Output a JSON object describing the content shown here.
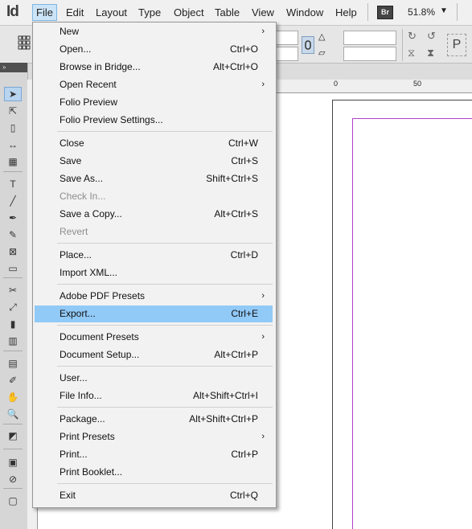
{
  "app": {
    "logo": "Id"
  },
  "menubar": {
    "items": [
      "File",
      "Edit",
      "Layout",
      "Type",
      "Object",
      "Table",
      "View",
      "Window",
      "Help"
    ],
    "bridge_badge": "Br",
    "zoom": "51.8%",
    "zoom_caret": "▼"
  },
  "panel": {
    "collapse": "»"
  },
  "ruler": {
    "tick_0": "0",
    "tick_50": "50"
  },
  "file_menu": {
    "items": [
      {
        "label": "New",
        "shortcut": "",
        "submenu": true,
        "enabled": true
      },
      {
        "label": "Open...",
        "shortcut": "Ctrl+O",
        "submenu": false,
        "enabled": true
      },
      {
        "label": "Browse in Bridge...",
        "shortcut": "Alt+Ctrl+O",
        "submenu": false,
        "enabled": true
      },
      {
        "label": "Open Recent",
        "shortcut": "",
        "submenu": true,
        "enabled": true
      },
      {
        "label": "Folio Preview",
        "shortcut": "",
        "submenu": false,
        "enabled": true
      },
      {
        "label": "Folio Preview Settings...",
        "shortcut": "",
        "submenu": false,
        "enabled": true
      },
      {
        "label": "Close",
        "shortcut": "Ctrl+W",
        "submenu": false,
        "enabled": true
      },
      {
        "label": "Save",
        "shortcut": "Ctrl+S",
        "submenu": false,
        "enabled": true
      },
      {
        "label": "Save As...",
        "shortcut": "Shift+Ctrl+S",
        "submenu": false,
        "enabled": true
      },
      {
        "label": "Check In...",
        "shortcut": "",
        "submenu": false,
        "enabled": false
      },
      {
        "label": "Save a Copy...",
        "shortcut": "Alt+Ctrl+S",
        "submenu": false,
        "enabled": true
      },
      {
        "label": "Revert",
        "shortcut": "",
        "submenu": false,
        "enabled": false
      },
      {
        "label": "Place...",
        "shortcut": "Ctrl+D",
        "submenu": false,
        "enabled": true
      },
      {
        "label": "Import XML...",
        "shortcut": "",
        "submenu": false,
        "enabled": true
      },
      {
        "label": "Adobe PDF Presets",
        "shortcut": "",
        "submenu": true,
        "enabled": true
      },
      {
        "label": "Export...",
        "shortcut": "Ctrl+E",
        "submenu": false,
        "enabled": true
      },
      {
        "label": "Document Presets",
        "shortcut": "",
        "submenu": true,
        "enabled": true
      },
      {
        "label": "Document Setup...",
        "shortcut": "Alt+Ctrl+P",
        "submenu": false,
        "enabled": true
      },
      {
        "label": "User...",
        "shortcut": "",
        "submenu": false,
        "enabled": true
      },
      {
        "label": "File Info...",
        "shortcut": "Alt+Shift+Ctrl+I",
        "submenu": false,
        "enabled": true
      },
      {
        "label": "Package...",
        "shortcut": "Alt+Shift+Ctrl+P",
        "submenu": false,
        "enabled": true
      },
      {
        "label": "Print Presets",
        "shortcut": "",
        "submenu": true,
        "enabled": true
      },
      {
        "label": "Print...",
        "shortcut": "Ctrl+P",
        "submenu": false,
        "enabled": true
      },
      {
        "label": "Print Booklet...",
        "shortcut": "",
        "submenu": false,
        "enabled": true
      },
      {
        "label": "Exit",
        "shortcut": "Ctrl+Q",
        "submenu": false,
        "enabled": true
      }
    ],
    "highlighted": "Export...",
    "submenu_arrow": "›"
  },
  "tools": [
    "selection-tool",
    "direct-selection-tool",
    "page-tool",
    "gap-tool",
    "content-collector-tool",
    "type-tool",
    "line-tool",
    "pen-tool",
    "pencil-tool",
    "rectangle-frame-tool",
    "rectangle-tool",
    "scissors-tool",
    "free-transform-tool",
    "gradient-swatch-tool",
    "gradient-feather-tool",
    "note-tool",
    "eyedropper-tool",
    "hand-tool",
    "zoom-tool",
    "fill-stroke-swatch",
    "formatting-affects-container",
    "apply-none",
    "normal-view-mode"
  ],
  "tool_glyphs": [
    "➤",
    "⇱",
    "▯",
    "↔",
    "▦",
    "T",
    "╱",
    "✒",
    "✎",
    "⊠",
    "▭",
    "✂",
    "⤢",
    "▮",
    "▥",
    "▤",
    "✐",
    "✋",
    "🔍",
    "◩",
    "▣",
    "⊘",
    "▢"
  ],
  "colors": {
    "menu_highlight": "#91c9f7",
    "margin_guide": "#b040c8"
  }
}
